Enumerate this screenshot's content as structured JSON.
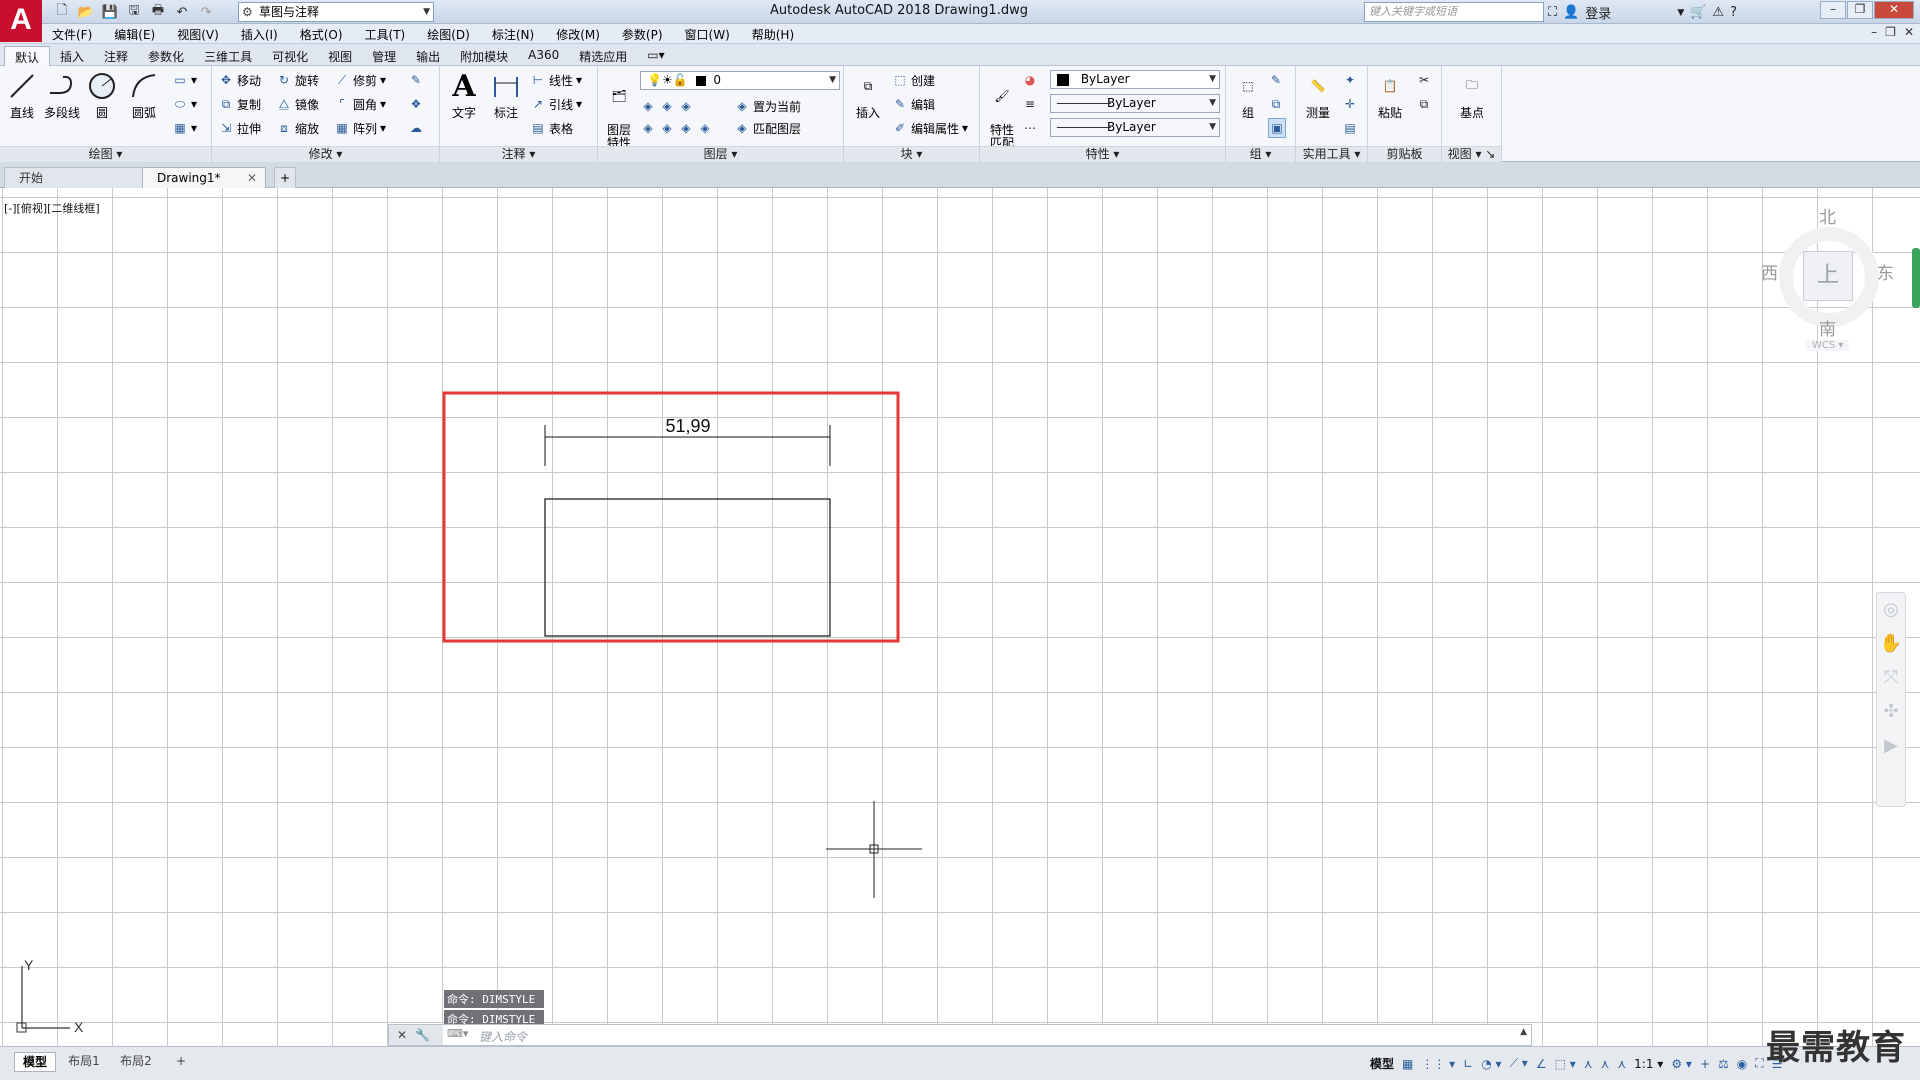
{
  "app": {
    "logo_letter": "A",
    "title": "Autodesk AutoCAD 2018    Drawing1.dwg",
    "workspace": "草图与注释",
    "search_placeholder": "键入关键字或短语",
    "login": "登录"
  },
  "menu": [
    "文件(F)",
    "编辑(E)",
    "视图(V)",
    "插入(I)",
    "格式(O)",
    "工具(T)",
    "绘图(D)",
    "标注(N)",
    "修改(M)",
    "参数(P)",
    "窗口(W)",
    "帮助(H)"
  ],
  "ribbon_tabs": [
    "默认",
    "插入",
    "注释",
    "参数化",
    "三维工具",
    "可视化",
    "视图",
    "管理",
    "输出",
    "附加模块",
    "A360",
    "精选应用"
  ],
  "ribbon": {
    "draw": {
      "title": "绘图",
      "line": "直线",
      "polyline": "多段线",
      "circle": "圆",
      "arc": "圆弧"
    },
    "modify": {
      "title": "修改",
      "move": "移动",
      "rotate": "旋转",
      "trim": "修剪",
      "copy": "复制",
      "mirror": "镜像",
      "fillet": "圆角",
      "stretch": "拉伸",
      "scale": "缩放",
      "array": "阵列"
    },
    "annotation": {
      "title": "注释",
      "text": "文字",
      "dimension": "标注",
      "linear": "线性",
      "leader": "引线",
      "table": "表格"
    },
    "layers": {
      "title": "图层",
      "layer_props": "图层\n特性",
      "current_layer": "0",
      "set_current": "置为当前",
      "match_layer": "匹配图层"
    },
    "block": {
      "title": "块",
      "insert": "插入",
      "create": "创建",
      "edit": "编辑",
      "edit_attr": "编辑属性"
    },
    "properties": {
      "title": "特性",
      "match": "特性\n匹配",
      "color": "ByLayer",
      "linetype": "ByLayer",
      "lineweight": "ByLayer"
    },
    "groups": {
      "title": "组",
      "group": "组"
    },
    "utilities": {
      "title": "实用工具",
      "measure": "测量"
    },
    "clipboard": {
      "title": "剪贴板",
      "paste": "粘贴"
    },
    "view": {
      "title": "视图",
      "base": "基点"
    }
  },
  "file_tabs": {
    "start": "开始",
    "drawing": "Drawing1*",
    "plus": "+"
  },
  "viewport": {
    "label": "[-][俯视][二维线框]",
    "viewcube": {
      "north": "北",
      "south": "南",
      "east": "东",
      "west": "西",
      "face": "上",
      "wcs": "WCS"
    },
    "dimension_text": "51,99",
    "ucs": {
      "x": "X",
      "y": "Y"
    }
  },
  "command": {
    "history": [
      "命令: DIMSTYLE",
      "命令: DIMSTYLE"
    ],
    "placeholder": "键入命令"
  },
  "layout_tabs": {
    "model": "模型",
    "layout1": "布局1",
    "layout2": "布局2",
    "plus": "+"
  },
  "status": {
    "model": "模型",
    "scale": "1:1"
  },
  "watermark": "最需教育",
  "colors": {
    "highlight_rect": "#e53935",
    "accent": "#c8102e"
  }
}
